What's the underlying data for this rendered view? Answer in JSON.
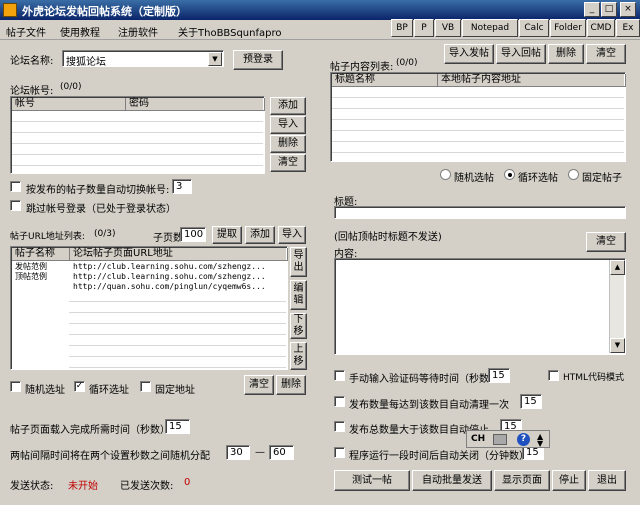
{
  "window": {
    "title": "外虎论坛发帖回帖系统（定制版）",
    "controls": [
      "_",
      "□",
      "×"
    ]
  },
  "menu": [
    "帖子文件",
    "使用教程",
    "注册软件",
    "关于ThoBBSqunfapro"
  ],
  "toolbar": [
    "BP",
    "P",
    "VB",
    "Notepad",
    "Calc",
    "Folder",
    "CMD",
    "Ex"
  ],
  "forum": {
    "name_label": "论坛名称:",
    "selected": "搜狐论坛",
    "prelogin": "预登录"
  },
  "accounts": {
    "label": "论坛帐号:",
    "count": "(0/0)",
    "columns": [
      "帐号",
      "密码"
    ],
    "buttons": [
      "添加",
      "导入",
      "删除",
      "清空"
    ]
  },
  "switch_option": {
    "label": "按发布的帖子数量自动切换帐号:",
    "value": "3",
    "checked": false
  },
  "skip_option": {
    "label": "跳过帐号登录（已处于登录状态）",
    "checked": false
  },
  "url_list": {
    "label": "帖子URL地址列表:",
    "count": "(0/3)",
    "pages_label": "子页数:",
    "pages_value": "100",
    "buttons": [
      "提取",
      "添加",
      "导入"
    ],
    "columns": [
      "帖子名称",
      "论坛帖子页面URL地址"
    ],
    "rows": [
      {
        "name": "发帖范例",
        "url": "http://club.learning.sohu.com/szhengz..."
      },
      {
        "name": "顶帖范例",
        "url": "http://club.learning.sohu.com/szhengz..."
      },
      {
        "name": "",
        "url": "http://quan.sohu.com/pinglun/cyqemw6s..."
      }
    ],
    "side_buttons": [
      "导出",
      "编辑",
      "下移",
      "上移"
    ],
    "options": [
      {
        "label": "随机选址",
        "checked": false
      },
      {
        "label": "循环选址",
        "checked": true
      },
      {
        "label": "固定地址",
        "checked": false
      }
    ],
    "bottom_buttons": [
      "清空",
      "删除"
    ]
  },
  "load_time": {
    "label": "帖子页面载入完成所需时间（秒数）",
    "value": "15"
  },
  "interval": {
    "label": "两帖间隔时间将在两个设置秒数之间随机分配",
    "from": "30",
    "dash": "—",
    "to": "60"
  },
  "status": {
    "label": "发送状态:",
    "value": "未开始",
    "count_label": "已发送次数:",
    "count_value": "0"
  },
  "post_content": {
    "label": "帖子内容列表:",
    "count": "(0/0)",
    "buttons": [
      "导入发帖",
      "导入回帖",
      "删除",
      "清空"
    ],
    "columns": [
      "标题名称",
      "本地帖子内容地址"
    ],
    "modes": [
      {
        "label": "随机选帖",
        "selected": false
      },
      {
        "label": "循环选帖",
        "selected": true
      },
      {
        "label": "固定帖子",
        "selected": false
      }
    ],
    "title_label": "标题:",
    "title_note": "(回帖顶帖时标题不发送)",
    "content_label": "内容:",
    "clear": "清空"
  },
  "settings": {
    "captcha": {
      "label": "手动输入验证码等待时间（秒数）",
      "value": "15",
      "checked": false
    },
    "html_mode": {
      "label": "HTML代码模式",
      "checked": false
    },
    "clear_once": {
      "label": "发布数量每达到该数目自动清理一次",
      "value": "15",
      "checked": false
    },
    "auto_stop": {
      "label": "发布总数量大于该数目自动停止",
      "value": "15",
      "checked": false
    },
    "auto_close": {
      "label": "程序运行一段时间后自动关闭（分钟数）",
      "value": "15",
      "checked": false
    }
  },
  "ime_bar": [
    "CH"
  ],
  "actions": [
    "测试一帖",
    "自动批量发送",
    "显示页面",
    "停止",
    "退出"
  ],
  "colors": {
    "title_bar": "#0a246a",
    "face": "#d4d0c8",
    "status_value": "#c00000"
  }
}
